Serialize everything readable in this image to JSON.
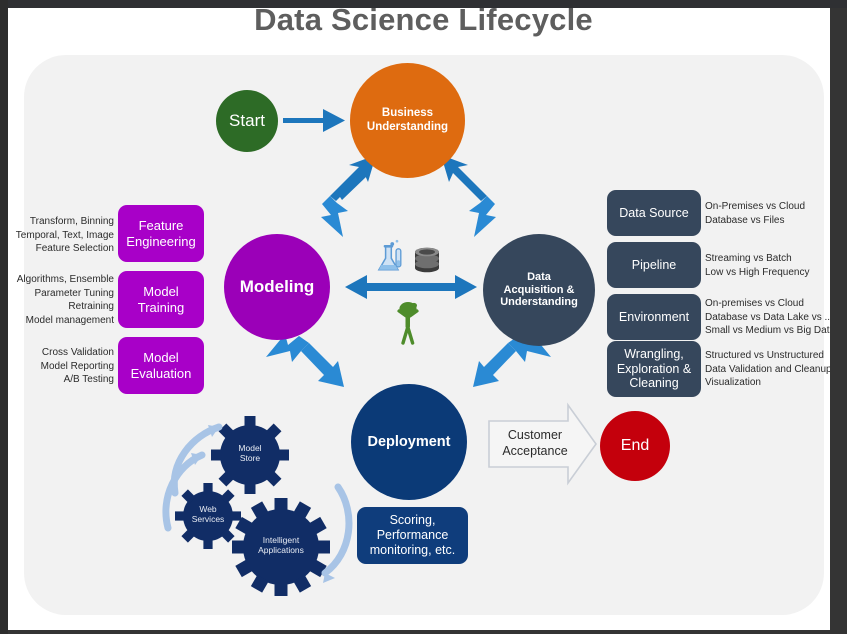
{
  "diagram": {
    "title": "Data Science Lifecycle",
    "nodes": {
      "start": {
        "label": "Start",
        "color": "#2D6B26"
      },
      "business": {
        "label": "Business\nUnderstanding",
        "line1": "Business",
        "line2": "Understanding",
        "color": "#DE6B10"
      },
      "modeling": {
        "label": "Modeling",
        "color": "#9B00B8"
      },
      "data_acq": {
        "line1": "Data",
        "line2": "Acquisition &",
        "line3": "Understanding",
        "color": "#36475C"
      },
      "deployment": {
        "label": "Deployment",
        "color": "#0B3A77"
      },
      "end": {
        "label": "End",
        "color": "#C4000C"
      }
    },
    "left_boxes": [
      {
        "label_line1": "Feature",
        "label_line2": "Engineering",
        "notes": [
          "Transform, Binning",
          "Temporal, Text, Image",
          "Feature Selection"
        ]
      },
      {
        "label_line1": "Model",
        "label_line2": "Training",
        "notes": [
          "Algorithms, Ensemble",
          "Parameter Tuning",
          "Retraining",
          "Model management"
        ]
      },
      {
        "label_line1": "Model",
        "label_line2": "Evaluation",
        "notes": [
          "Cross Validation",
          "Model Reporting",
          "A/B Testing"
        ]
      }
    ],
    "left_box_color": "#A800C8",
    "right_boxes": [
      {
        "label_line1": "Data Source",
        "label_line2": "",
        "label_line3": "",
        "notes": [
          "On-Premises vs Cloud",
          "Database vs Files"
        ]
      },
      {
        "label_line1": "Pipeline",
        "label_line2": "",
        "label_line3": "",
        "notes": [
          "Streaming vs Batch",
          "Low vs High Frequency"
        ]
      },
      {
        "label_line1": "Environment",
        "label_line2": "",
        "label_line3": "",
        "notes": [
          "On-premises vs Cloud",
          "Database vs Data Lake  vs ..",
          "Small vs Medium vs Big Data"
        ]
      },
      {
        "label_line1": "Wrangling,",
        "label_line2": "Exploration &",
        "label_line3": "Cleaning",
        "notes": [
          "Structured vs Unstructured",
          "Data Validation and Cleanup",
          "Visualization"
        ]
      }
    ],
    "right_box_color": "#36475C",
    "gears": [
      {
        "line1": "Model",
        "line2": "Store"
      },
      {
        "line1": "Web",
        "line2": "Services"
      },
      {
        "line1": "Intelligent",
        "line2": "Applications"
      }
    ],
    "gear_color": "#112D66",
    "scoring_box": {
      "line1": "Scoring,",
      "line2": "Performance",
      "line3": "monitoring, etc.",
      "color": "#0F3D7C"
    },
    "customer_arrow": {
      "line1": "Customer",
      "line2": "Acceptance"
    },
    "center_icons": [
      "flask-icon",
      "database-icon",
      "person-with-idea-icon"
    ],
    "arrow_color": "#1D76BC"
  }
}
